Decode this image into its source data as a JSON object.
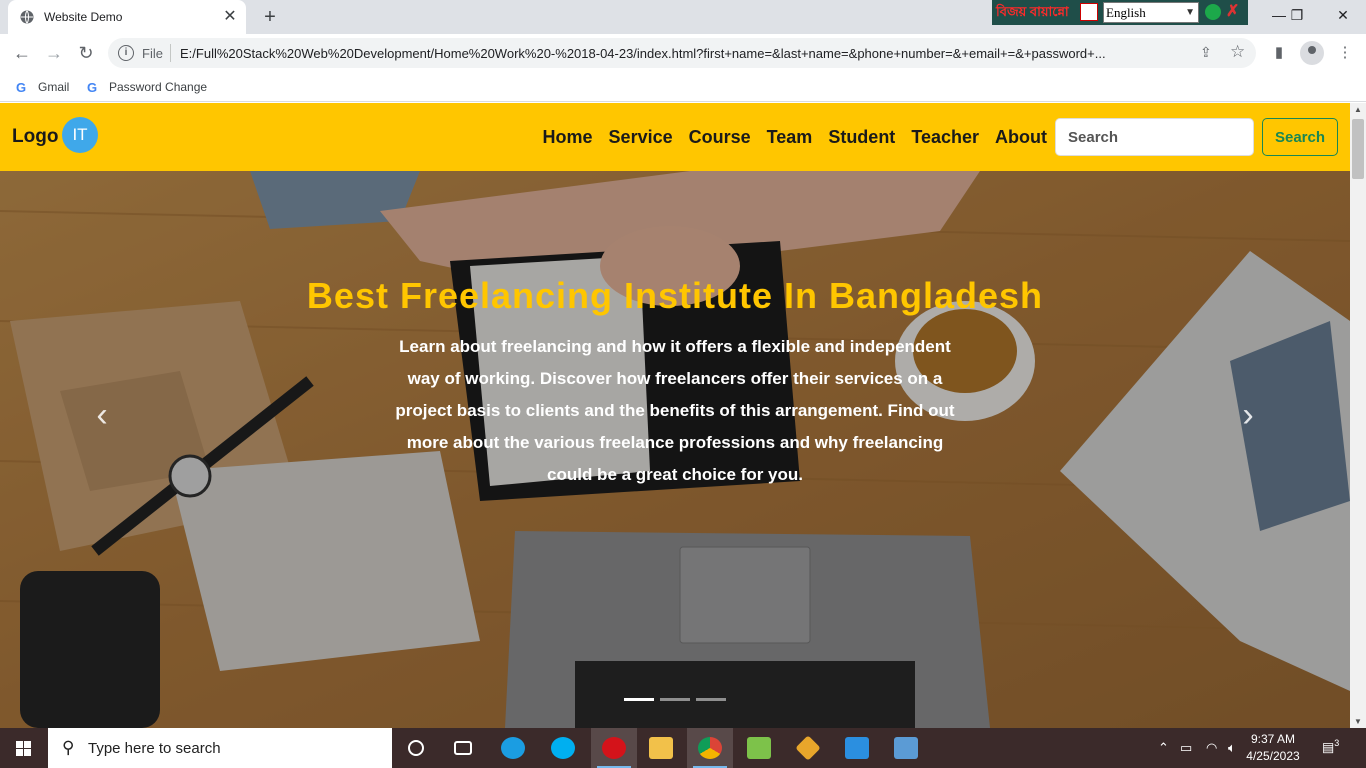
{
  "browser": {
    "tab_title": "Website Demo",
    "tab_close": "✕",
    "new_tab": "+",
    "ime": {
      "bangla_label": "বিজয় বায়ান্নো",
      "language": "English"
    },
    "window_controls": {
      "minimize": "—",
      "restore": "❐",
      "close": "✕"
    },
    "nav": {
      "back": "←",
      "forward": "→",
      "reload": "↻"
    },
    "omnibox": {
      "scheme_label": "File",
      "url": "E:/Full%20Stack%20Web%20Development/Home%20Work%20-%2018-04-23/index.html?first+name=&last+name=&phone+number=&+email+=&+password+..."
    },
    "bookmarks": [
      {
        "label": "Gmail"
      },
      {
        "label": "Password Change"
      }
    ]
  },
  "site": {
    "logo_text": "Logo",
    "logo_badge": "IT",
    "nav_links": [
      "Home",
      "Service",
      "Course",
      "Team",
      "Student",
      "Teacher",
      "About"
    ],
    "search_placeholder": "Search",
    "search_button": "Search",
    "brand_color": "#ffc600",
    "hero": {
      "title": "Best Freelancing Institute In Bangladesh",
      "text": "Learn about freelancing and how it offers a flexible and independent way of working. Discover how freelancers offer their services on a project basis to clients and the benefits of this arrangement. Find out more about the various freelance professions and why freelancing could be a great choice for you.",
      "prev_icon": "‹",
      "next_icon": "›",
      "slides": 3,
      "active_slide": 1
    }
  },
  "taskbar": {
    "search_placeholder": "Type here to search",
    "time": "9:37 AM",
    "date": "4/25/2023",
    "notifications": "3"
  }
}
